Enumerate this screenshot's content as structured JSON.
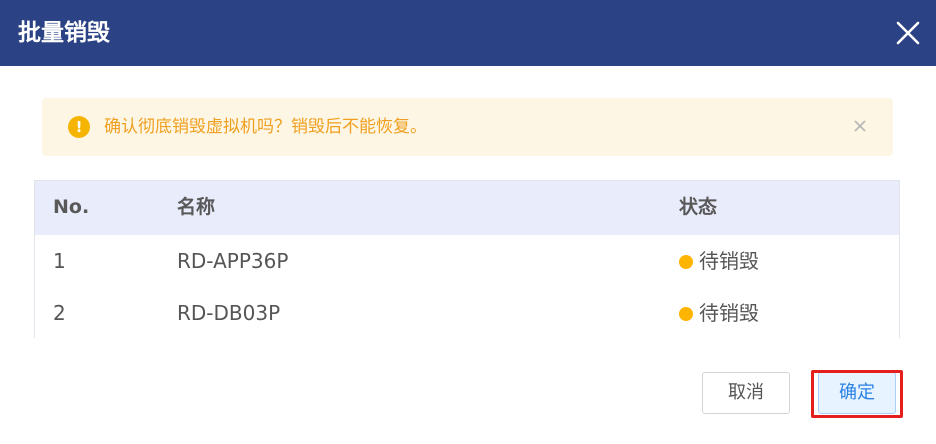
{
  "dialog": {
    "title": "批量销毁",
    "close_icon": "close-icon"
  },
  "alert": {
    "icon": "exclamation-circle-icon",
    "message": "确认彻底销毁虚拟机吗？销毁后不能恢复。",
    "close_icon": "close-icon",
    "color": "#f0a020",
    "background": "#fdf6e5"
  },
  "table": {
    "columns": [
      "No.",
      "名称",
      "状态"
    ],
    "rows": [
      {
        "no": "1",
        "name": "RD-APP36P",
        "status": "待销毁",
        "status_color": "#ffb400"
      },
      {
        "no": "2",
        "name": "RD-DB03P",
        "status": "待销毁",
        "status_color": "#ffb400"
      }
    ]
  },
  "footer": {
    "cancel_label": "取消",
    "confirm_label": "确定"
  },
  "colors": {
    "header": "#2b4385",
    "highlight": "#e5201c",
    "primary": "#2a82e4"
  }
}
